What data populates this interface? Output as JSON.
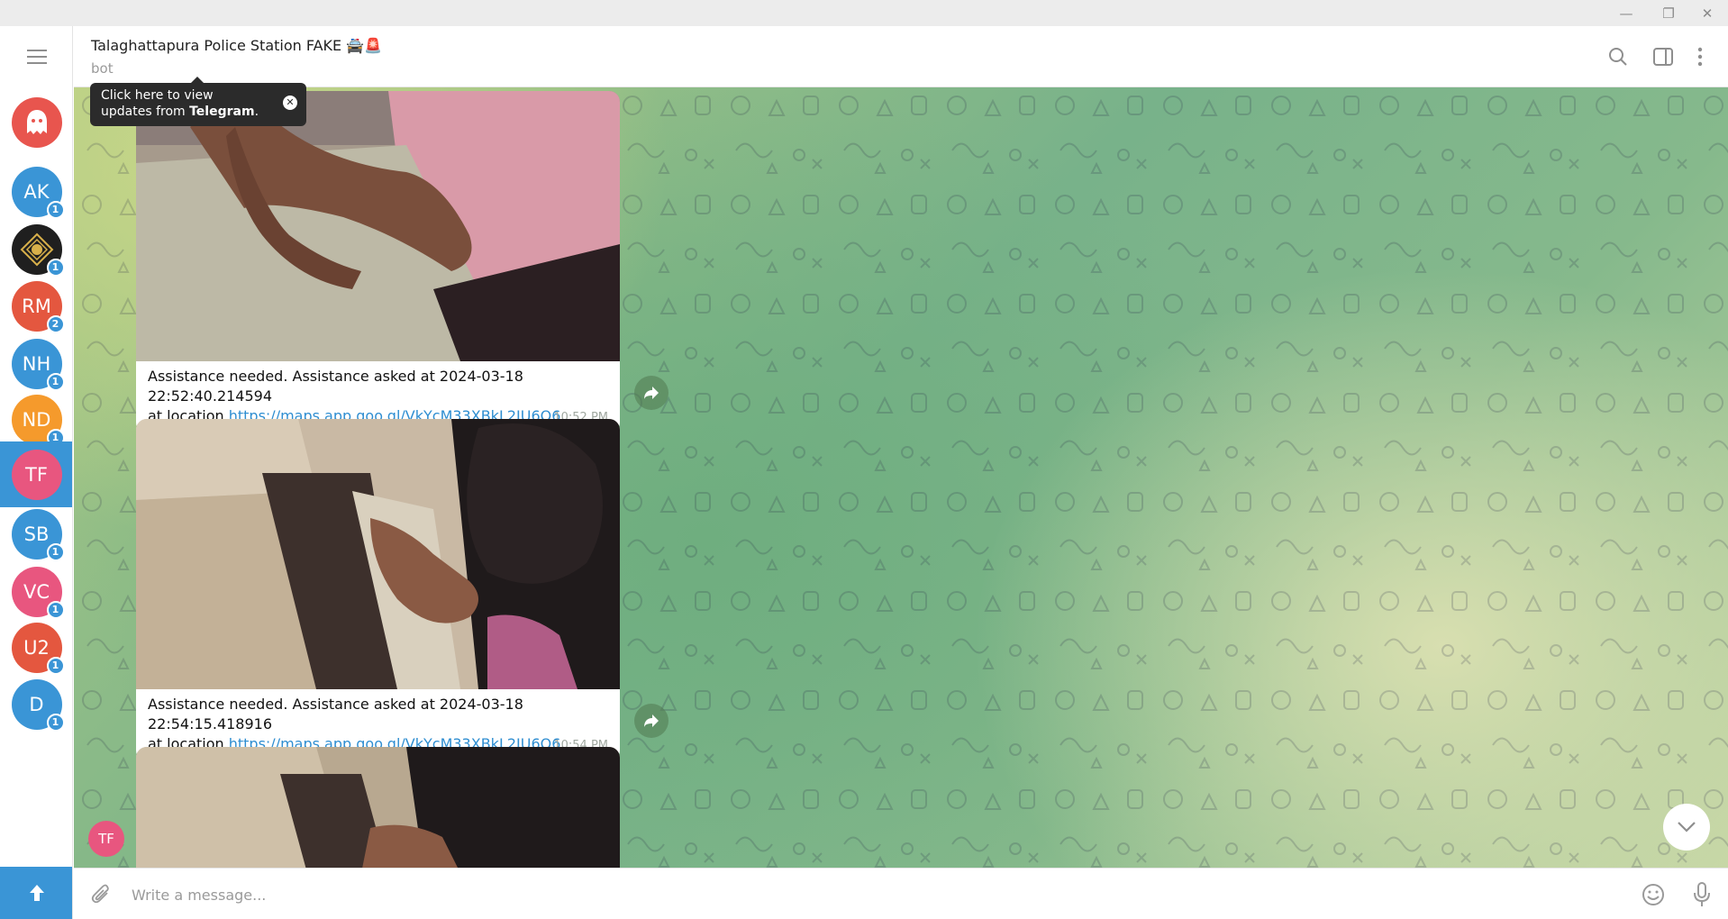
{
  "window": {
    "minimize": "—",
    "restore": "❐",
    "close": "✕"
  },
  "rail": {
    "avatars": [
      {
        "initials": "",
        "color": "#e8554e",
        "icon": "ghost-icon",
        "badge": ""
      },
      {
        "initials": "AK",
        "color": "#3a95d6",
        "badge": "1"
      },
      {
        "initials": "",
        "color": "#1f1f1f",
        "icon": "gold-logo-icon",
        "badge": "1"
      },
      {
        "initials": "RM",
        "color": "#e4573f",
        "badge": "2"
      },
      {
        "initials": "NH",
        "color": "#3a95d6",
        "badge": "1"
      },
      {
        "initials": "ND",
        "color": "#f59a2c",
        "badge": "1"
      },
      {
        "initials": "TF",
        "color": "#e8567f",
        "badge": ""
      },
      {
        "initials": "SB",
        "color": "#3a95d6",
        "badge": "1"
      },
      {
        "initials": "VC",
        "color": "#e8567f",
        "badge": "1"
      },
      {
        "initials": "U2",
        "color": "#e4573f",
        "badge": "1"
      },
      {
        "initials": "D",
        "color": "#3a95d6",
        "badge": "1"
      }
    ]
  },
  "header": {
    "title": "Talaghattapura Police Station FAKE 🚔🚨",
    "subtitle": "bot"
  },
  "tooltip": {
    "line1": "Click here to view",
    "line2_prefix": "updates from ",
    "line2_bold": "Telegram",
    "line2_suffix": "."
  },
  "messages": [
    {
      "text": "Assistance needed. Assistance asked at 2024-03-18 22:52:40.214594",
      "location_prefix": "at location ",
      "link": "https://maps.app.goo.gl/VkYcM33XBkL2JU6Q6",
      "time": "10:52 PM"
    },
    {
      "text": "Assistance needed. Assistance asked at 2024-03-18 22:54:15.418916",
      "location_prefix": "at location ",
      "link": "https://maps.app.goo.gl/VkYcM33XBkL2JU6Q6",
      "time": "10:54 PM"
    }
  ],
  "sender_avatar": "TF",
  "composer": {
    "placeholder": "Write a message..."
  },
  "colors": {
    "accent": "#3a95d6",
    "link": "#2f8ed1"
  }
}
